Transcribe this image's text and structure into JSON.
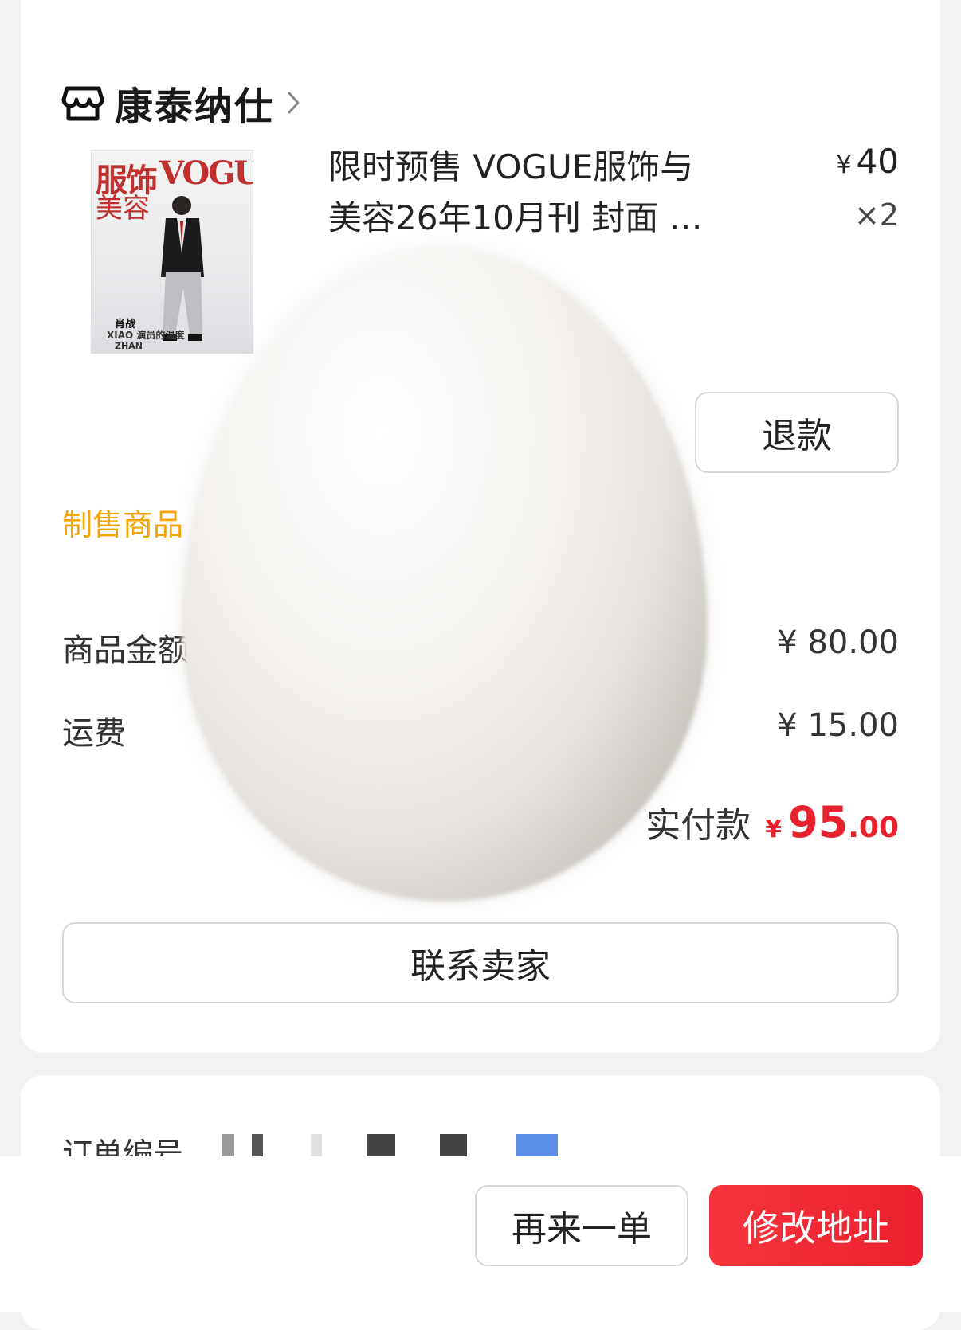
{
  "shop": {
    "name": "康泰纳仕",
    "icon": "store-icon"
  },
  "product": {
    "title": "限时预售 VOGUE服饰与美容26年10月刊 封面 …",
    "title_line1": "限时预售 VOGUE服饰与",
    "title_line2": "美容26年10月刊 封面 …",
    "price_symbol": "¥",
    "price": "40",
    "quantity": "×2",
    "thumbnail": {
      "masthead_cn_1": "服饰",
      "masthead_cn_2": "美容",
      "masthead_en": "VOGUE",
      "cover_name_cn": "肖战",
      "cover_line": "XIAO 演员的温度",
      "cover_name_en": "ZHAN"
    }
  },
  "actions": {
    "refund_label": "退款"
  },
  "presale_note": "制售商品",
  "summary": {
    "goods_amount_label": "商品金额",
    "goods_amount_value": "¥ 80.00",
    "shipping_label": "运费",
    "shipping_value": "¥ 15.00",
    "paid_label": "实付款",
    "paid_symbol": "¥",
    "paid_integer": "95",
    "paid_decimal": ".00"
  },
  "contact_seller_label": "联系卖家",
  "order_info": {
    "order_number_label": "订单编号"
  },
  "bottom_bar": {
    "reorder_label": "再来一单",
    "modify_address_label": "修改地址"
  },
  "colors": {
    "accent_red": "#e8212f",
    "presale_orange": "#f3a400",
    "border_gray": "#d6d6d6"
  }
}
